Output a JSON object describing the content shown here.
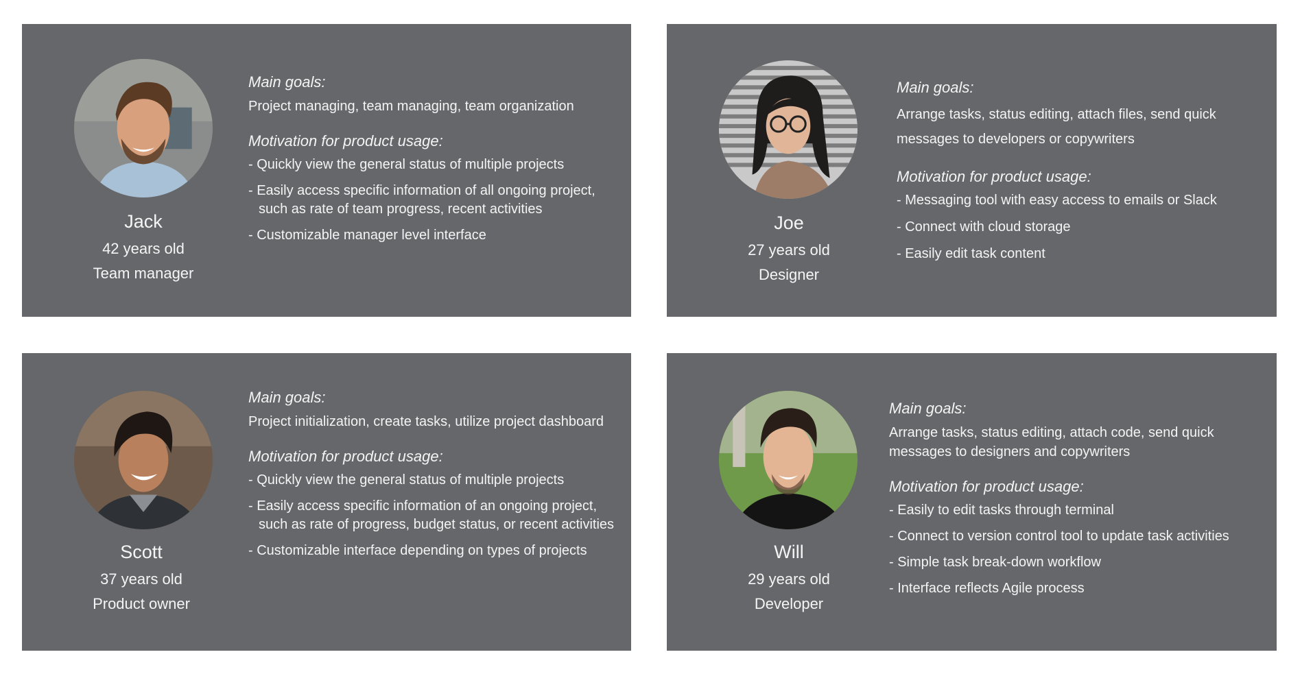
{
  "personas": [
    {
      "name": "Jack",
      "age": "42 years old",
      "role": "Team manager",
      "goals_heading": "Main goals:",
      "goals": "Project managing, team managing, team organization",
      "motivation_heading": "Motivation for product usage:",
      "motivations": [
        "- Quickly view the general status of multiple projects",
        "- Easily access specific information of all ongoing project, such as rate of team progress, recent activities",
        "- Customizable manager level interface"
      ]
    },
    {
      "name": "Joe",
      "age": "27 years old",
      "role": "Designer",
      "goals_heading": "Main goals:",
      "goals": "Arrange tasks, status editing, attach files, send quick messages to developers or copywriters",
      "motivation_heading": "Motivation for product usage:",
      "motivations": [
        "- Messaging tool with easy access to emails or Slack",
        "- Connect with cloud storage",
        "- Easily edit task content"
      ]
    },
    {
      "name": "Scott",
      "age": "37 years old",
      "role": "Product owner",
      "goals_heading": "Main goals:",
      "goals": "Project initialization, create tasks, utilize project dashboard",
      "motivation_heading": "Motivation for product usage:",
      "motivations": [
        "- Quickly view the general status of multiple projects",
        "- Easily access specific information of an ongoing project, such as rate of progress, budget status, or recent activities",
        "- Customizable interface depending on types of projects"
      ]
    },
    {
      "name": "Will",
      "age": "29 years old",
      "role": "Developer",
      "goals_heading": "Main goals:",
      "goals": "Arrange tasks, status editing, attach code, send quick messages to designers and copywriters",
      "motivation_heading": "Motivation for product usage:",
      "motivations": [
        "- Easily to edit tasks through terminal",
        "- Connect to version control tool to update task activities",
        "- Simple task break-down workflow",
        "- Interface reflects Agile process"
      ]
    }
  ],
  "colors": {
    "card_background": "#65676a",
    "page_background": "#ffffff",
    "text": "#ffffff"
  },
  "icons": {
    "avatar_0": "man-with-beard-photo",
    "avatar_1": "woman-with-glasses-photo",
    "avatar_2": "smiling-man-photo",
    "avatar_3": "young-man-black-shirt-photo"
  }
}
